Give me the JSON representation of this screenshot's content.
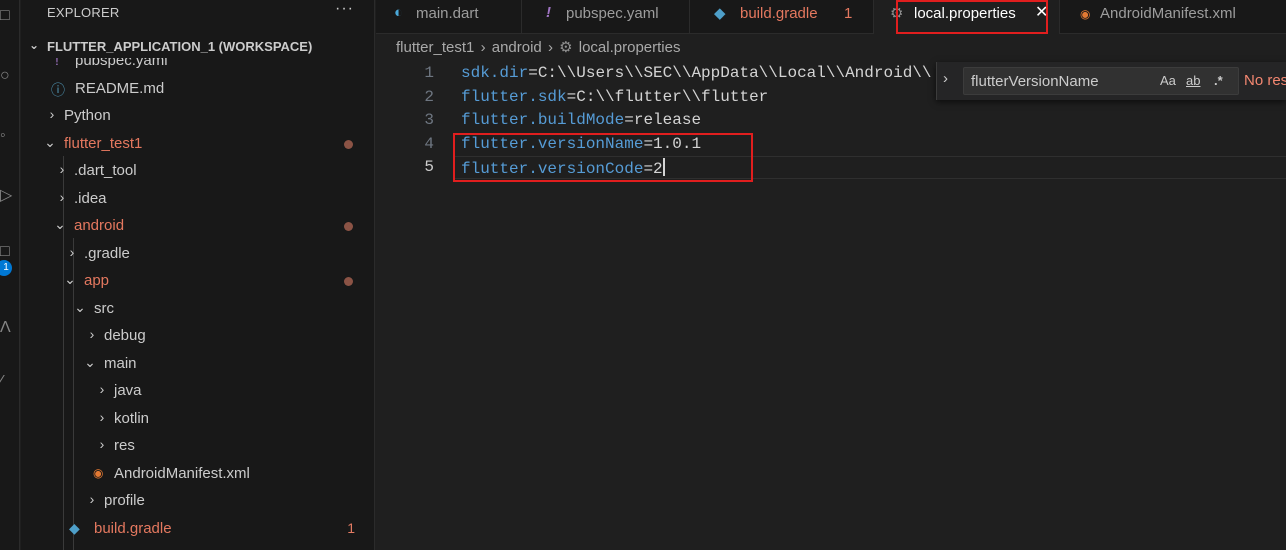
{
  "sidebar": {
    "title": "EXPLORER",
    "more": "···",
    "workspace": "FLUTTER_APPLICATION_1 (WORKSPACE)",
    "items": [
      {
        "label": "pubspec.yaml",
        "icon": "!"
      },
      {
        "label": "README.md",
        "icon": "ⓘ"
      },
      {
        "label": "Python"
      },
      {
        "label": "flutter_test1"
      },
      {
        "label": ".dart_tool"
      },
      {
        "label": ".idea"
      },
      {
        "label": "android"
      },
      {
        "label": ".gradle"
      },
      {
        "label": "app"
      },
      {
        "label": "src"
      },
      {
        "label": "debug"
      },
      {
        "label": "main"
      },
      {
        "label": "java"
      },
      {
        "label": "kotlin"
      },
      {
        "label": "res"
      },
      {
        "label": "AndroidManifest.xml"
      },
      {
        "label": "profile"
      },
      {
        "label": "build.gradle",
        "problems": "1"
      }
    ]
  },
  "activity_badge": "1",
  "tabs": [
    {
      "label": "main.dart",
      "icon": "dart-icon"
    },
    {
      "label": "pubspec.yaml",
      "icon": "yaml-icon"
    },
    {
      "label": "build.gradle",
      "problems": "1",
      "icon": "gradle-icon"
    },
    {
      "label": "local.properties",
      "icon": "gear-icon",
      "close": "✕"
    },
    {
      "label": "AndroidManifest.xml",
      "icon": "rss-icon"
    }
  ],
  "breadcrumb": [
    "flutter_test1",
    "android",
    "local.properties"
  ],
  "editor": {
    "lines": [
      {
        "num": "1",
        "key": "sdk.dir",
        "eq": "=",
        "value": "C:\\\\Users\\\\SEC\\\\AppData\\\\Local\\\\Android\\\\"
      },
      {
        "num": "2",
        "key": "flutter.sdk",
        "eq": "=",
        "value": "C:\\\\flutter\\\\flutter"
      },
      {
        "num": "3",
        "key": "flutter.buildMode",
        "eq": "=",
        "value": "release"
      },
      {
        "num": "4",
        "key": "flutter.versionName",
        "eq": "=",
        "value": "1.0.1"
      },
      {
        "num": "5",
        "key": "flutter.versionCode",
        "eq": "=",
        "value": "2"
      }
    ]
  },
  "find": {
    "toggle": "›",
    "query": "flutterVersionName",
    "match_case": "Aa",
    "whole_word": "ab",
    "regex": ".*",
    "result": "No results"
  },
  "colors": {
    "highlight": "#e01e1e",
    "modified": "#e4785f",
    "key": "#569cd6"
  }
}
